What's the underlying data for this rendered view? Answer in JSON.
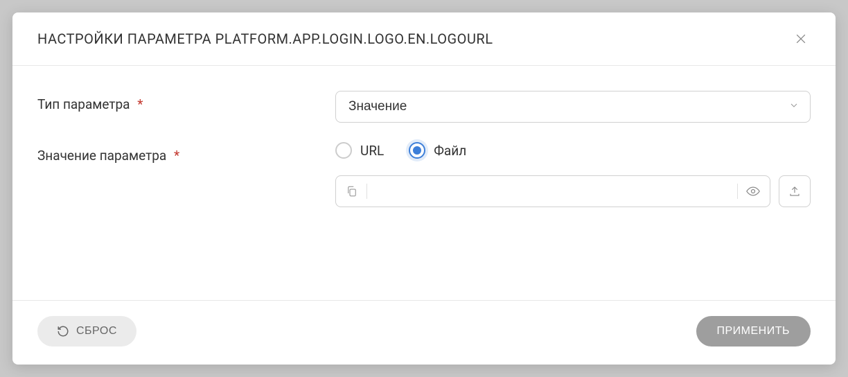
{
  "modal": {
    "title": "НАСТРОЙКИ ПАРАМЕТРА PLATFORM.APP.LOGIN.LOGO.EN.LOGOURL"
  },
  "form": {
    "paramType": {
      "label": "Тип параметра",
      "value": "Значение"
    },
    "paramValue": {
      "label": "Значение параметра",
      "radioUrl": "URL",
      "radioFile": "Файл",
      "fileValue": ""
    }
  },
  "footer": {
    "reset": "СБРОС",
    "apply": "ПРИМЕНИТЬ"
  }
}
